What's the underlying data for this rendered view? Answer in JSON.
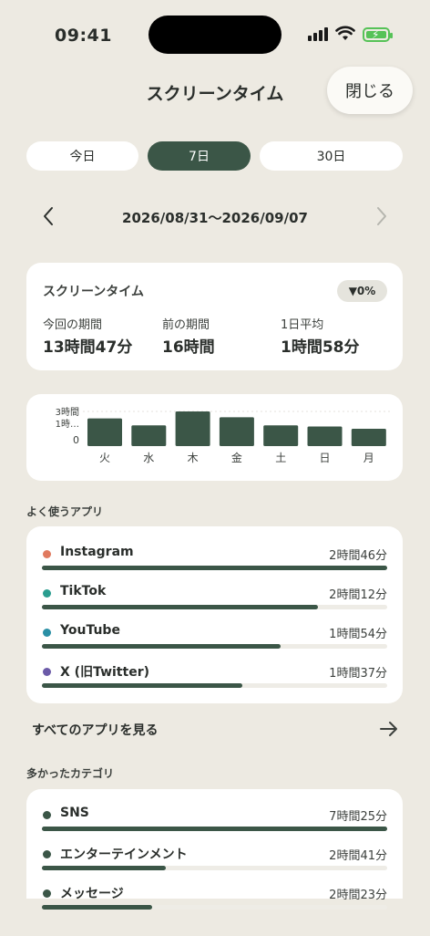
{
  "status": {
    "time": "09:41"
  },
  "header": {
    "title": "スクリーンタイム",
    "close_label": "閉じる"
  },
  "segments": [
    {
      "label": "今日",
      "selected": false
    },
    {
      "label": "7日",
      "selected": true
    },
    {
      "label": "30日",
      "selected": false
    }
  ],
  "date_range": "2026/08/31〜2026/09/07",
  "summary": {
    "title": "スクリーンタイム",
    "change_badge": "▼0%",
    "current_label": "今回の期間",
    "current_value": "13時間47分",
    "previous_label": "前の期間",
    "previous_value": "16時間",
    "avg_label": "1日平均",
    "avg_value": "1時間58分"
  },
  "chart_data": {
    "type": "bar",
    "categories": [
      "火",
      "水",
      "木",
      "金",
      "土",
      "日",
      "月"
    ],
    "values": [
      2.4,
      1.8,
      3.0,
      2.5,
      1.8,
      1.7,
      1.5
    ],
    "y_tick_labels": [
      "3時間",
      "1時…",
      "0"
    ],
    "ylim": [
      0,
      3
    ],
    "color": "#3b5647"
  },
  "frequent_apps": {
    "section_title": "よく使うアプリ",
    "items": [
      {
        "name": "Instagram",
        "duration": "2時間46分",
        "color": "#e07a5f",
        "fraction": 1.0
      },
      {
        "name": "TikTok",
        "duration": "2時間12分",
        "color": "#2a9d8f",
        "fraction": 0.8
      },
      {
        "name": "YouTube",
        "duration": "1時間54分",
        "color": "#2a8fa5",
        "fraction": 0.69
      },
      {
        "name": "X (旧Twitter)",
        "duration": "1時間37分",
        "color": "#6b5aa8",
        "fraction": 0.58
      }
    ],
    "see_all_label": "すべてのアプリを見る"
  },
  "categories": {
    "section_title": "多かったカテゴリ",
    "items": [
      {
        "name": "SNS",
        "duration": "7時間25分",
        "color": "#3b5647",
        "fraction": 1.0
      },
      {
        "name": "エンターテインメント",
        "duration": "2時間41分",
        "color": "#3b5647",
        "fraction": 0.36
      },
      {
        "name": "メッセージ",
        "duration": "2時間23分",
        "color": "#3b5647",
        "fraction": 0.32
      }
    ]
  }
}
